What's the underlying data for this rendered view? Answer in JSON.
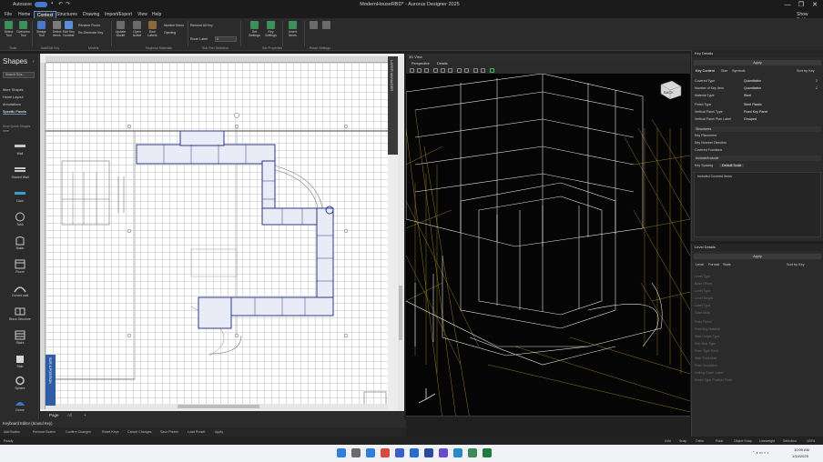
{
  "titlebar": {
    "autosave_label": "Autosave",
    "toggle_state": "On",
    "title": "ModernHouseRBD* - Aurorus Designer 2025",
    "window_buttons": [
      "—",
      "❐",
      "✕"
    ]
  },
  "menu": {
    "items": [
      "File",
      "Home",
      "Context",
      "Structures",
      "Drawing",
      "Import/Export",
      "View",
      "Help"
    ],
    "active": "Context",
    "right_label": "Show Settings"
  },
  "ribbon": {
    "groups": [
      "Tools",
      "Add/Edit Key",
      "Models",
      "Regional Materials",
      "Sub Part Selection",
      "Set Properties",
      "Room Settings"
    ],
    "buttons": [
      "Select Tool",
      "Overview Tool",
      "Bridge Tool",
      "Select Items",
      "Edit Key Number",
      "Update Model",
      "Open Active",
      "Set Settings",
      "Key Settings",
      "Insert Items"
    ],
    "small_items": [
      "Rename Floors",
      "Re-Generate Key",
      "Door Labels",
      "Number Items",
      "Opening",
      "Remove All Key"
    ],
    "size_field_label": "Room Label",
    "size_value": "0"
  },
  "shapes": {
    "title": "Shapes",
    "search_placeholder": "Search Sha...",
    "stencils": [
      "More Shapes",
      "Home Layout",
      "Annotations",
      "Specific Panels"
    ],
    "selected_stencil": "Specific Panels",
    "hint": "Drop Quick Shapes here",
    "items": [
      "Wall",
      "Shared Wall",
      "Door",
      "Tank",
      "Basin",
      "Room",
      "Curved wall",
      "Block Structure",
      "Stairs",
      "Slab",
      "Sphere",
      "Dome"
    ]
  },
  "canvas": {
    "layer_label": "LAYER MANAGER",
    "size_position_label": "SIZE & POSITION",
    "page_tab": "Page",
    "all_label": "All",
    "add_label": "+"
  },
  "view3d": {
    "title": "3D View",
    "tabs": [
      "Perspective",
      "Details"
    ],
    "cube_label": "BACK"
  },
  "key_details": {
    "title": "Key Details",
    "apply_label": "Apply",
    "tabs": [
      "Key Content",
      "Size",
      "Symbols"
    ],
    "tab_right": "Sort by Key",
    "rows": [
      {
        "k": "Covered Type",
        "v": "Quantitative",
        "n": "2"
      },
      {
        "k": "Number of Key Item",
        "v": "Quantitative",
        "n": "2"
      },
      {
        "k": "Material Type",
        "v": "Steel",
        "n": ""
      },
      {
        "k": "Finish Type",
        "v": "Steel Plastic",
        "n": ""
      },
      {
        "k": "Vertical Panel Type",
        "v": "Fixed Key Panel",
        "n": ""
      },
      {
        "k": "Vertical Panel Plan Label",
        "v": "Grouped",
        "n": ""
      }
    ],
    "sections": [
      "Structures",
      "Key Definitions",
      "Include/Include"
    ],
    "section_rows": [
      "Key Placement",
      "Key Number Direction",
      "Covered Functions"
    ],
    "grid_label": "Key Spacing",
    "grid_value": "Default Scale",
    "notes_label": "Included Covered Items"
  },
  "level_details": {
    "title": "Level Details",
    "apply_label": "Apply",
    "tabs": [
      "Level",
      "Format",
      "Stats"
    ],
    "tab_right": "Sort by Key",
    "dim_rows": [
      "Level Type",
      "Base Offset",
      "Level Type",
      "Level Height",
      "Label Type",
      "Total Units",
      "Floor Finish",
      "Finishing Material",
      "Stair Height Type",
      "Sub-floor Type",
      "Floor Type Point",
      "Slab Thickness",
      "Floor Insulation",
      "Ceiling Cover Label",
      "Room Type Position Point"
    ]
  },
  "keyboard": {
    "title": "Keyboard Editor (Sound Key)",
    "items": [
      "Add Button",
      "Remove Button",
      "Confirm Changes",
      "Reset Keys",
      "Cancel Changes",
      "Save Preset",
      "Load Preset",
      "Apply"
    ]
  },
  "status": {
    "left": "Ready",
    "right_items": [
      "Grid",
      "Snap",
      "Ortho",
      "Polar",
      "Object Snap",
      "Lineweight",
      "Selection"
    ],
    "zoom": "100%"
  },
  "taskbar": {
    "time": "10:05 AM",
    "date": "1/14/2025"
  },
  "colors": {
    "accent": "#4a78c8",
    "wall_stroke": "#2a3a8a",
    "wireframe_white": "#e6e6e6",
    "wireframe_yellow": "#c9a227"
  }
}
